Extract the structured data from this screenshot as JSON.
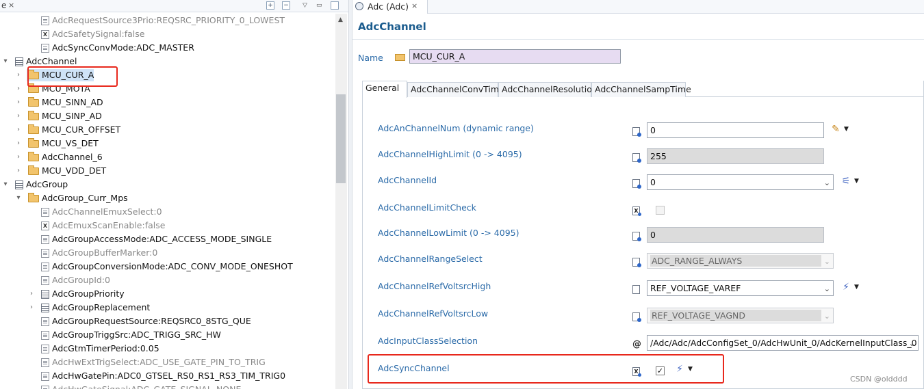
{
  "left_pane": {
    "tab_fragment": "e",
    "tab_close": "×",
    "toolbar": {
      "expand": "+",
      "collapse": "−"
    },
    "tree": [
      {
        "text": "AdcRequestSource3Prio:REQSRC_PRIORITY_0_LOWEST",
        "icon": "doc-icon",
        "gray": true
      },
      {
        "text": "AdcSafetySignal:false",
        "icon": "boolean-doc-icon",
        "gray": true
      },
      {
        "text": "AdcSyncConvMode:ADC_MASTER",
        "icon": "doc-icon",
        "gray": false
      },
      {
        "text": "AdcChannel",
        "icon": "table-icon",
        "gray": false,
        "expanded": true
      },
      {
        "text": "MCU_CUR_A",
        "icon": "folder-icon",
        "gray": false,
        "selected": true
      },
      {
        "text": "MCU_MOTA",
        "icon": "folder-icon",
        "gray": false
      },
      {
        "text": "MCU_SINN_AD",
        "icon": "folder-icon",
        "gray": false
      },
      {
        "text": "MCU_SINP_AD",
        "icon": "folder-icon",
        "gray": false
      },
      {
        "text": "MCU_CUR_OFFSET",
        "icon": "folder-icon",
        "gray": false
      },
      {
        "text": "MCU_VS_DET",
        "icon": "folder-icon",
        "gray": false
      },
      {
        "text": "AdcChannel_6",
        "icon": "folder-icon",
        "gray": false
      },
      {
        "text": "MCU_VDD_DET",
        "icon": "folder-icon",
        "gray": false
      },
      {
        "text": "AdcGroup",
        "icon": "table-icon",
        "gray": false,
        "expanded": true
      },
      {
        "text": "AdcGroup_Curr_Mps",
        "icon": "folder-icon",
        "gray": false,
        "expanded": true
      },
      {
        "text": "AdcChannelEmuxSelect:0",
        "icon": "doc-icon",
        "gray": true
      },
      {
        "text": "AdcEmuxScanEnable:false",
        "icon": "boolean-doc-icon",
        "gray": true
      },
      {
        "text": "AdcGroupAccessMode:ADC_ACCESS_MODE_SINGLE",
        "icon": "doc-icon",
        "gray": false
      },
      {
        "text": "AdcGroupBufferMarker:0",
        "icon": "doc-icon",
        "gray": true
      },
      {
        "text": "AdcGroupConversionMode:ADC_CONV_MODE_ONESHOT",
        "icon": "doc-icon",
        "gray": false
      },
      {
        "text": "AdcGroupId:0",
        "icon": "doc-icon",
        "gray": true
      },
      {
        "text": "AdcGroupPriority",
        "icon": "table-icon",
        "gray": false
      },
      {
        "text": "AdcGroupReplacement",
        "icon": "table-icon",
        "gray": false
      },
      {
        "text": "AdcGroupRequestSource:REQSRC0_8STG_QUE",
        "icon": "doc-icon",
        "gray": false
      },
      {
        "text": "AdcGroupTriggSrc:ADC_TRIGG_SRC_HW",
        "icon": "doc-icon",
        "gray": false
      },
      {
        "text": "AdcGtmTimerPeriod:0.05",
        "icon": "doc-icon",
        "gray": false
      },
      {
        "text": "AdcHwExtTrigSelect:ADC_USE_GATE_PIN_TO_TRIG",
        "icon": "doc-icon",
        "gray": true
      },
      {
        "text": "AdcHwGatePin:ADC0_GTSEL_RS0_RS1_RS3_TIM_TRIG0",
        "icon": "doc-icon",
        "gray": false
      },
      {
        "text": "AdcHwGateSignal:ADC_GATE_SIGNAL_NONE",
        "icon": "doc-icon",
        "gray": true
      }
    ]
  },
  "editor": {
    "tab_label": "Adc (Adc)",
    "tab_close": "×",
    "section_title": "AdcChannel",
    "name_label": "Name",
    "name_value": "MCU_CUR_A",
    "subtabs": [
      "General",
      "AdcChannelConvTime",
      "AdcChannelResolution",
      "AdcChannelSampTime"
    ],
    "params": [
      {
        "label": "AdcAnChannelNum (dynamic range)",
        "kind": "input",
        "value": "0",
        "tool": "pencil"
      },
      {
        "label": "AdcChannelHighLimit (0 -> 4095)",
        "kind": "input-readonly",
        "value": "255"
      },
      {
        "label": "AdcChannelId",
        "kind": "select",
        "value": "0",
        "tool": "wand"
      },
      {
        "label": "AdcChannelLimitCheck",
        "kind": "checkbox-disabled",
        "checked": false
      },
      {
        "label": "AdcChannelLowLimit (0 -> 4095)",
        "kind": "input-readonly",
        "value": "0"
      },
      {
        "label": "AdcChannelRangeSelect",
        "kind": "select-disabled",
        "value": "ADC_RANGE_ALWAYS"
      },
      {
        "label": "AdcChannelRefVoltsrcHigh",
        "kind": "select",
        "value": "REF_VOLTAGE_VAREF",
        "tool": "link"
      },
      {
        "label": "AdcChannelRefVoltsrcLow",
        "kind": "select-disabled",
        "value": "REF_VOLTAGE_VAGND"
      },
      {
        "label": "AdcInputClassSelection",
        "kind": "select",
        "value": "/Adc/Adc/AdcConfigSet_0/AdcHwUnit_0/AdcKernelInputClass_0"
      },
      {
        "label": "AdcSyncChannel",
        "kind": "checkbox",
        "checked": true,
        "check_glyph": "✓",
        "tool": "link"
      }
    ]
  },
  "watermark": "CSDN @oldddd",
  "colors": {
    "highlight_box": "#e8281c",
    "label_blue": "#2a6aa8",
    "title_blue": "#1b5c8e",
    "selection": "#cfe3f7"
  }
}
